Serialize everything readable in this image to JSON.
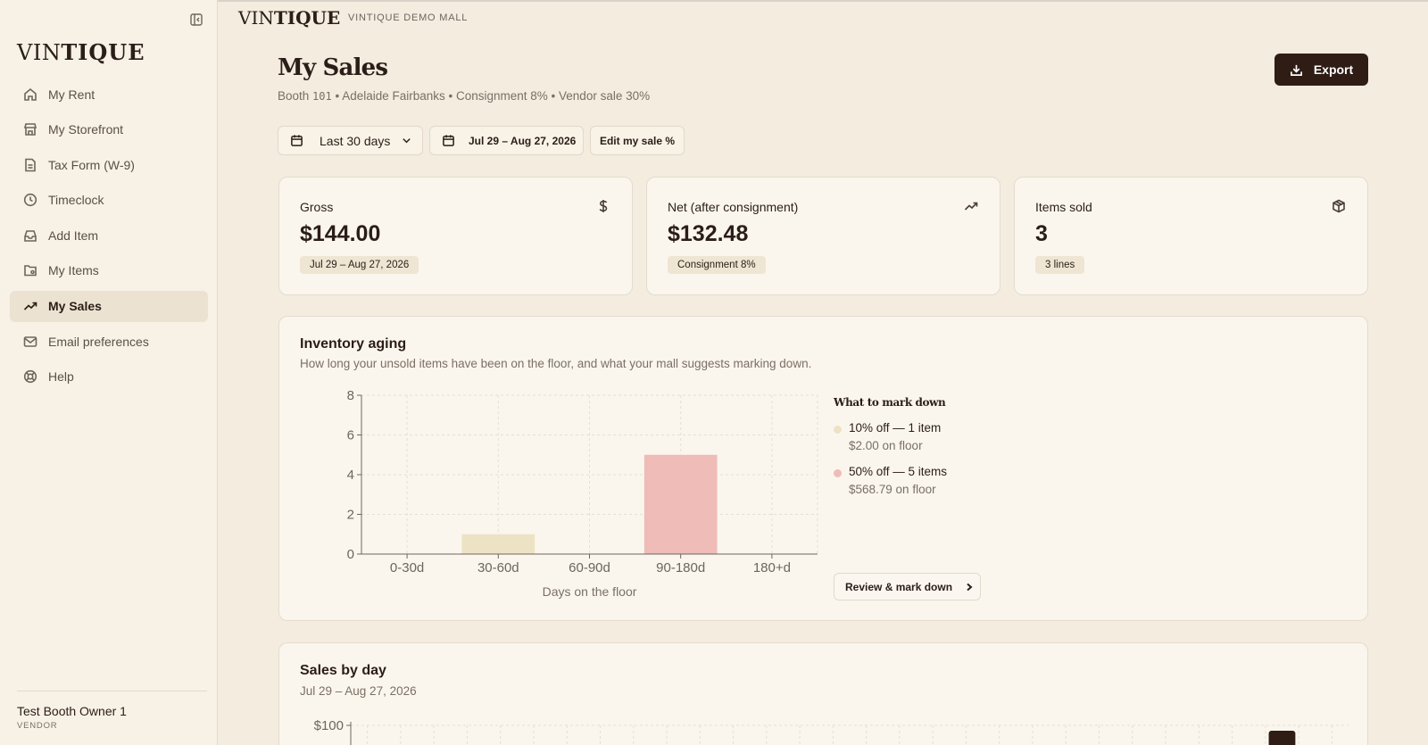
{
  "sidebar": {
    "brand_light": "VIN",
    "brand_bold": "TIQUE",
    "items": [
      {
        "label": "My Rent",
        "icon": "home-icon"
      },
      {
        "label": "My Storefront",
        "icon": "storefront-icon"
      },
      {
        "label": "Tax Form (W-9)",
        "icon": "document-icon"
      },
      {
        "label": "Timeclock",
        "icon": "clock-icon"
      },
      {
        "label": "Add Item",
        "icon": "inbox-icon"
      },
      {
        "label": "My Items",
        "icon": "folder-tag-icon"
      },
      {
        "label": "My Sales",
        "icon": "trending-up-icon",
        "active": true
      },
      {
        "label": "Email preferences",
        "icon": "mail-icon"
      },
      {
        "label": "Help",
        "icon": "lifebuoy-icon"
      }
    ],
    "user_name": "Test Booth Owner 1",
    "user_role": "VENDOR"
  },
  "header": {
    "brand_light": "VIN",
    "brand_bold": "TIQUE",
    "mall_name": "VINTIQUE DEMO MALL"
  },
  "page": {
    "title": "My Sales",
    "booth_label": "Booth ",
    "booth_number": "101",
    "subtitle_rest": " • Adelaide Fairbanks • Consignment 8% • Vendor sale 30%",
    "export_label": "Export"
  },
  "filters": {
    "range_label": "Last 30 days",
    "date_range": "Jul 29 – Aug 27, 2026",
    "edit_sale_label": "Edit my sale %"
  },
  "stats": [
    {
      "label": "Gross",
      "value": "$144.00",
      "badge": "Jul 29 – Aug 27, 2026",
      "icon": "dollar-icon"
    },
    {
      "label": "Net (after consignment)",
      "value": "$132.48",
      "badge": "Consignment 8%",
      "icon": "trending-up-icon"
    },
    {
      "label": "Items sold",
      "value": "3",
      "badge": "3 lines",
      "icon": "package-icon"
    }
  ],
  "aging": {
    "title": "Inventory aging",
    "description": "How long your unsold items have been on the floor, and what your mall suggests marking down.",
    "markdown_title": "What to mark down",
    "markdowns": [
      {
        "label": "10% off — 1 item",
        "sub": "$2.00 on floor",
        "color": "#ede2c4"
      },
      {
        "label": "50% off — 5 items",
        "sub": "$568.79 on floor",
        "color": "#efbcb8"
      }
    ],
    "review_label": "Review & mark down"
  },
  "sales": {
    "title": "Sales by day",
    "date_range": "Jul 29 – Aug 27, 2026"
  },
  "chart_data": [
    {
      "type": "bar",
      "categories": [
        "0-30d",
        "30-60d",
        "60-90d",
        "90-180d",
        "180+d"
      ],
      "values": [
        0,
        1,
        0,
        5,
        0
      ],
      "colors": [
        "#ede2c4",
        "#ede2c4",
        "#ede2c4",
        "#efbcb8",
        "#efbcb8"
      ],
      "xlabel": "Days on the floor",
      "ylabel": "",
      "ylim": [
        0,
        8
      ],
      "yticks": [
        "0",
        "2",
        "4",
        "6",
        "8"
      ],
      "grid": true
    },
    {
      "type": "bar",
      "yticks": [
        "$100"
      ],
      "grid": true,
      "bar_color": "#2e1c15"
    }
  ]
}
